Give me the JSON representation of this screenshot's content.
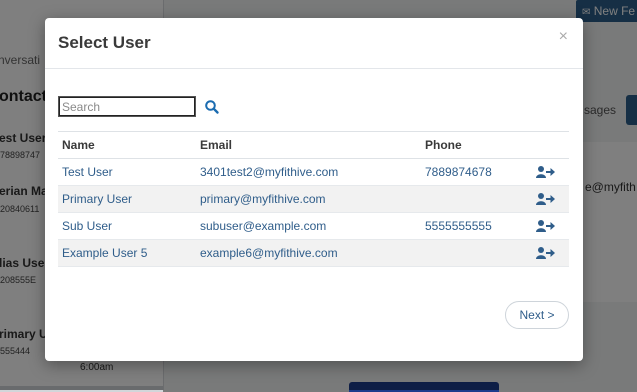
{
  "background": {
    "top_button_label": "New Fe",
    "left_header": "ontacts",
    "conversations_fragment": "nversati",
    "contacts": [
      {
        "name": "est User",
        "phone": "78898747"
      },
      {
        "name": "erian Ma",
        "phone": "20840611"
      },
      {
        "name": "lias Use",
        "phone": "208555E"
      },
      {
        "name": "rimary U",
        "phone": "555444"
      }
    ],
    "time_label": "6:00am",
    "messages_fragment": "sages",
    "email_fragment": "e@myfith"
  },
  "modal": {
    "title": "Select User",
    "close_label": "×",
    "search": {
      "placeholder": "Search",
      "value": ""
    },
    "columns": {
      "name": "Name",
      "email": "Email",
      "phone": "Phone"
    },
    "rows": [
      {
        "name": "Test User",
        "email": "3401test2@myfithive.com",
        "phone": "7889874678"
      },
      {
        "name": "Primary User",
        "email": "primary@myfithive.com",
        "phone": ""
      },
      {
        "name": "Sub User",
        "email": "subuser@example.com",
        "phone": "5555555555"
      },
      {
        "name": "Example User 5",
        "email": "example6@myfithive.com",
        "phone": ""
      }
    ],
    "next_label": "Next >",
    "accent_color": "#1a6bb0",
    "action_icon": "user-arrow-right-icon"
  }
}
